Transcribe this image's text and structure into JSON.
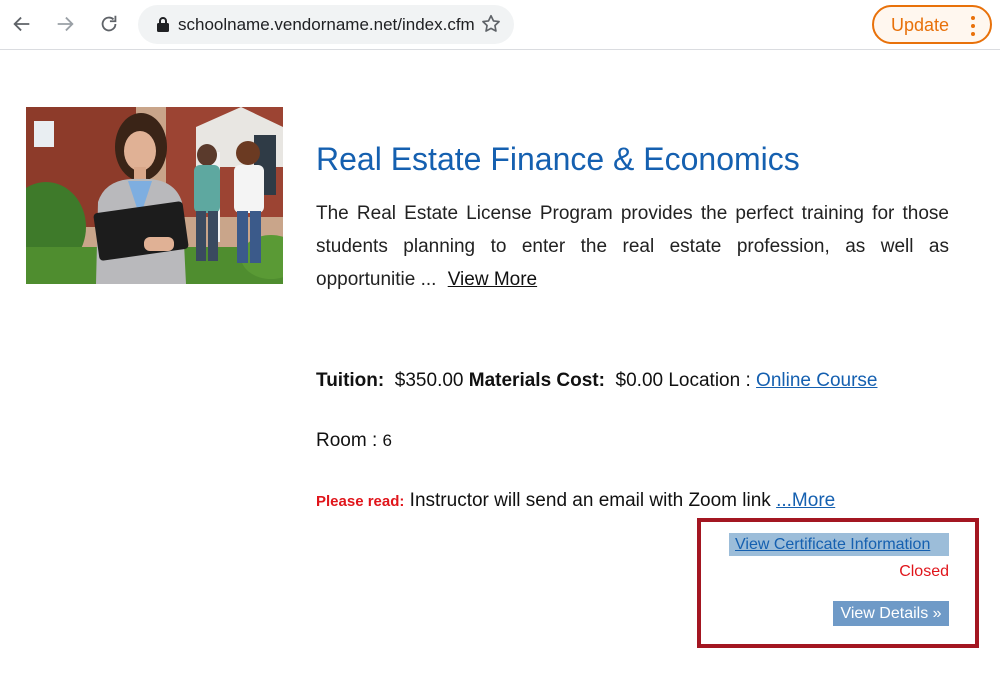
{
  "browser": {
    "url": "schoolname.vendorname.net/index.cfm",
    "update_label": "Update",
    "accent_color": "#e8710a"
  },
  "course": {
    "title": "Real Estate Finance & Economics",
    "description": "The Real Estate License Program provides the perfect training for those students planning to enter the real estate profession, as well as opportunitie ...",
    "view_more": "View More",
    "tuition_label": "Tuition:",
    "tuition_value": "$350.00",
    "materials_label": "Materials Cost:",
    "materials_value": "$0.00",
    "location_label": "Location :",
    "location_value": "Online Course",
    "room_label": "Room :",
    "room_value": "6",
    "please_read_label": "Please read:",
    "notice_text": "Instructor will send an email with Zoom link",
    "more_link": "...More",
    "certificate_link": "View Certificate Information",
    "status": "Closed",
    "details_button": "View Details »"
  },
  "colors": {
    "title_blue": "#1560b0",
    "alert_red": "#e0151b",
    "highlight_border": "#a31621",
    "details_bg": "#6f9ac7"
  }
}
